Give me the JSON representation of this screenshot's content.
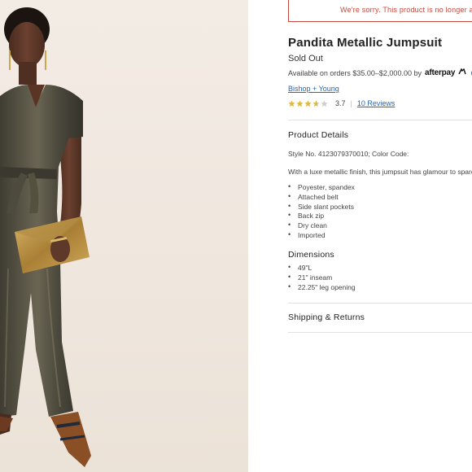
{
  "alert": {
    "message": "We're sorry. This product is no longer available."
  },
  "product": {
    "title": "Pandita Metallic Jumpsuit",
    "status": "Sold Out",
    "afterpay_text": "Available on orders $35.00–$2,000.00 by",
    "afterpay_logo": "afterpay",
    "afterpay_info_icon": "info-icon",
    "brand": "Bishop + Young",
    "rating": "3.7",
    "rating_value": 3.7,
    "rating_max": 5,
    "reviews_link": "10 Reviews",
    "star_color": "#e1b843"
  },
  "details": {
    "heading": "Product Details",
    "style_line": "Style No. 4123079370010; Color Code:",
    "description": "With a luxe metallic finish, this jumpsuit has glamour to spare.",
    "bullets": [
      "Poyester, spandex",
      "Attached belt",
      "Side slant pockets",
      "Back zip",
      "Dry clean",
      "Imported"
    ]
  },
  "dimensions": {
    "heading": "Dimensions",
    "bullets": [
      "49\"L",
      "21\" inseam",
      "22.25\" leg opening"
    ]
  },
  "shipping": {
    "heading": "Shipping & Returns"
  },
  "colors": {
    "alert": "#c8473d",
    "link": "#2a66b0"
  }
}
